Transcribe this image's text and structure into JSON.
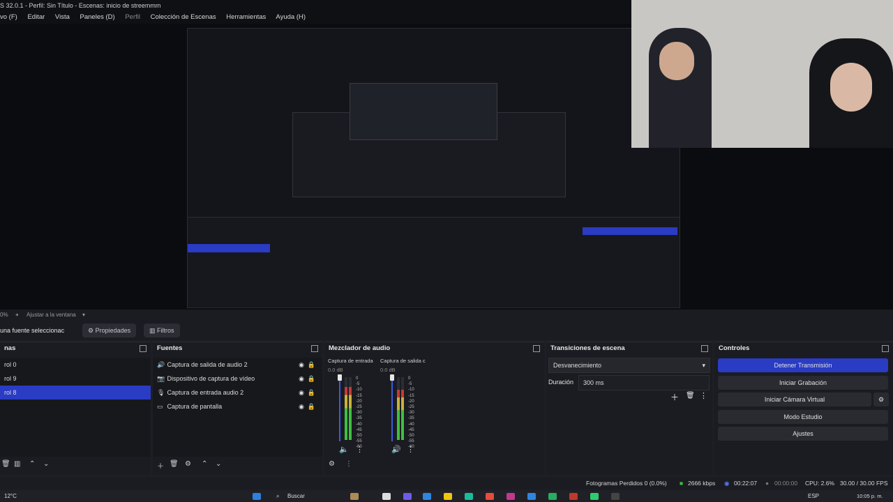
{
  "window": {
    "title": "S 32.0.1 - Perfil: Sin Título - Escenas: inicio de streemmm"
  },
  "menu": [
    {
      "label": "vo (F)",
      "dim": false
    },
    {
      "label": "Editar",
      "dim": false
    },
    {
      "label": "Vista",
      "dim": false
    },
    {
      "label": "Paneles (D)",
      "dim": false
    },
    {
      "label": "Perfil",
      "dim": true
    },
    {
      "label": "Colección de Escenas",
      "dim": false
    },
    {
      "label": "Herramientas",
      "dim": false
    },
    {
      "label": "Ayuda (H)",
      "dim": false
    }
  ],
  "zoom": {
    "percent": "0%",
    "fit_label": "Ajustar a la ventana"
  },
  "source_toolbar": {
    "no_source": "una fuente seleccionac",
    "properties": "Propiedades",
    "filters": "Filtros"
  },
  "scenes": {
    "header": "nas",
    "items": [
      {
        "label": "rol 0",
        "selected": false
      },
      {
        "label": "rol 9",
        "selected": false
      },
      {
        "label": "rol 8",
        "selected": true
      }
    ]
  },
  "sources": {
    "header": "Fuentes",
    "items": [
      {
        "label": "Captura de salida de audio 2",
        "icon": "speaker-icon"
      },
      {
        "label": "Dispositivo de captura de vídeo",
        "icon": "camera-icon"
      },
      {
        "label": "Captura de entrada audio 2",
        "icon": "microphone-icon"
      },
      {
        "label": "Captura de pantalla",
        "icon": "monitor-icon"
      }
    ]
  },
  "mixer": {
    "header": "Mezclador de audio",
    "channels": [
      {
        "name": "Captura de entrada",
        "db": "0.0 dB",
        "level": 0.85
      },
      {
        "name": "Captura de salida c",
        "db": "0.0 dB",
        "level": 0.8
      }
    ],
    "scale": [
      "0",
      "-5",
      "-10",
      "-15",
      "-20",
      "-25",
      "-30",
      "-35",
      "-40",
      "-45",
      "-50",
      "-55",
      "-60"
    ]
  },
  "transitions": {
    "header": "Transiciones de escena",
    "selected": "Desvanecimiento",
    "duration_label": "Duración",
    "duration_value": "300 ms"
  },
  "controls": {
    "header": "Controles",
    "stop_stream": "Detener Transmisión",
    "start_record": "Iniciar Grabación",
    "start_vcam": "Iniciar Cámara Virtual",
    "studio_mode": "Modo Estudio",
    "settings": "Ajustes"
  },
  "status": {
    "dropped_frames": "Fotogramas Perdidos 0 (0.0%)",
    "bitrate": "2666 kbps",
    "stream_time": "00:22:07",
    "record_time": "00:00:00",
    "cpu": "CPU: 2.6%",
    "fps": "30.00 / 30.00 FPS"
  },
  "taskbar": {
    "weather": "12°C",
    "search": "Buscar",
    "lang": "ESP",
    "time": "10:05 p. m."
  },
  "colors": {
    "accent": "#2a3bc4",
    "meter_green": "#3fbf3f",
    "meter_yellow": "#c8b23a",
    "meter_red": "#c53a3a"
  }
}
